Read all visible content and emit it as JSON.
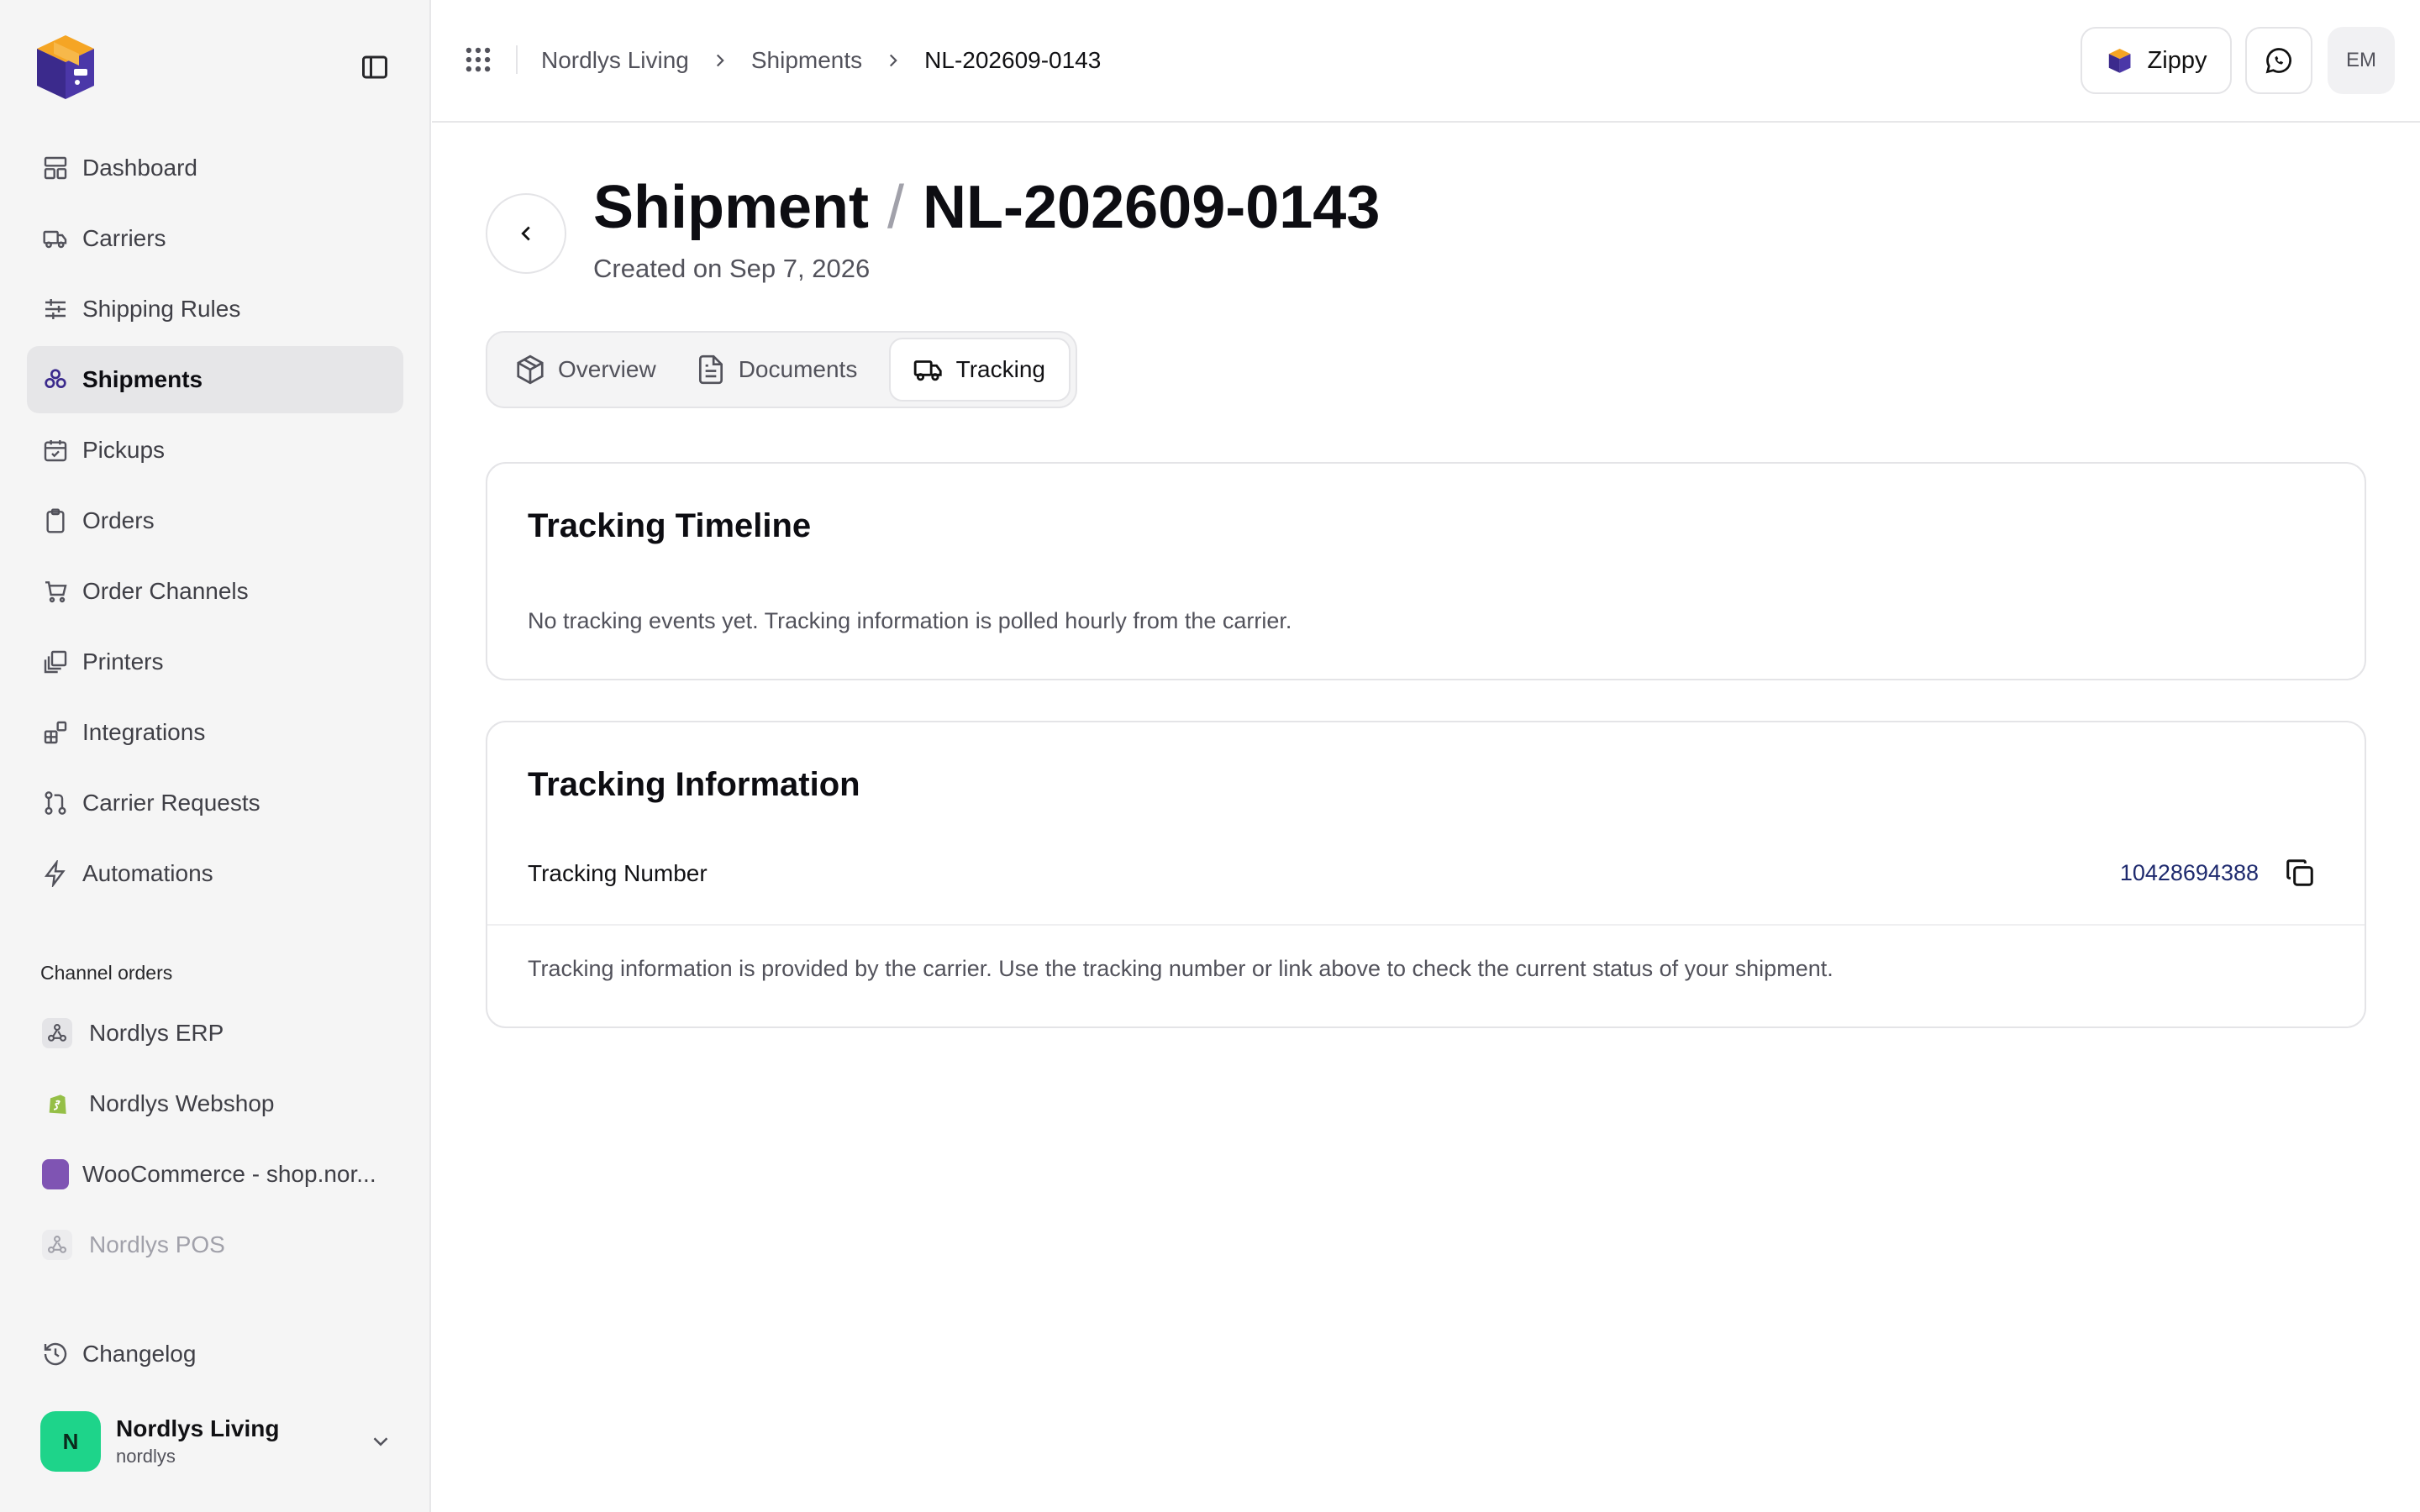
{
  "sidebar": {
    "items": [
      {
        "label": "Dashboard",
        "icon": "dashboard-icon"
      },
      {
        "label": "Carriers",
        "icon": "truck-icon"
      },
      {
        "label": "Shipping Rules",
        "icon": "sliders-icon"
      },
      {
        "label": "Shipments",
        "icon": "boxes-icon",
        "active": true
      },
      {
        "label": "Pickups",
        "icon": "calendar-check-icon"
      },
      {
        "label": "Orders",
        "icon": "clipboard-icon"
      },
      {
        "label": "Order Channels",
        "icon": "cart-icon"
      },
      {
        "label": "Printers",
        "icon": "printer-icon"
      },
      {
        "label": "Integrations",
        "icon": "blocks-icon"
      },
      {
        "label": "Carrier Requests",
        "icon": "git-pull-icon"
      },
      {
        "label": "Automations",
        "icon": "bolt-icon"
      }
    ],
    "channel_section_label": "Channel orders",
    "channels": [
      {
        "label": "Nordlys ERP",
        "icon": "webhook-icon"
      },
      {
        "label": "Nordlys Webshop",
        "icon": "shopify-icon"
      },
      {
        "label": "WooCommerce - shop.nor...",
        "icon": "woocommerce-icon"
      },
      {
        "label": "Nordlys POS",
        "icon": "webhook-icon",
        "muted": true
      }
    ],
    "changelog_label": "Changelog",
    "account": {
      "initial": "N",
      "name": "Nordlys Living",
      "handle": "nordlys"
    }
  },
  "header": {
    "breadcrumb": [
      "Nordlys Living",
      "Shipments",
      "NL-202609-0143"
    ],
    "assistant_label": "Zippy",
    "user_initials": "EM"
  },
  "page": {
    "title_prefix": "Shipment",
    "title_separator": "/",
    "title_id": "NL-202609-0143",
    "subtitle": "Created on Sep 7, 2026",
    "tabs": [
      {
        "label": "Overview",
        "icon": "package-icon"
      },
      {
        "label": "Documents",
        "icon": "document-icon"
      },
      {
        "label": "Tracking",
        "icon": "truck-icon",
        "active": true
      }
    ]
  },
  "timeline_card": {
    "title": "Tracking Timeline",
    "message": "No tracking events yet. Tracking information is polled hourly from the carrier."
  },
  "info_card": {
    "title": "Tracking Information",
    "tracking_number_label": "Tracking Number",
    "tracking_number": "10428694388",
    "note": "Tracking information is provided by the carrier. Use the tracking number or link above to check the current status of your shipment."
  },
  "colors": {
    "accent": "#3b2a8c",
    "logo_orange": "#f5a524",
    "avatar_green": "#1ed48a",
    "link_blue": "#1e2a6e"
  }
}
